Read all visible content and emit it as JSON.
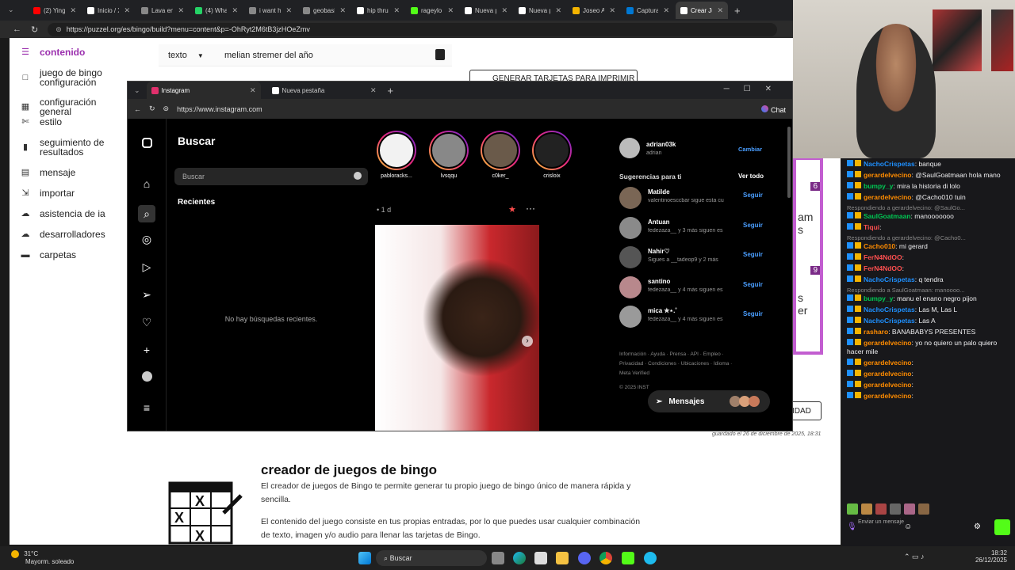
{
  "browser": {
    "tabs": [
      {
        "label": "(2) Ying y",
        "color": "#ff0000"
      },
      {
        "label": "Inicio / X",
        "color": "#ffffff"
      },
      {
        "label": "Lava en X",
        "color": "#888888"
      },
      {
        "label": "(4) Whats",
        "color": "#25d366"
      },
      {
        "label": "i want hi",
        "color": "#888888"
      },
      {
        "label": "geobasic",
        "color": "#888888"
      },
      {
        "label": "hip thrust",
        "color": "#ffffff"
      },
      {
        "label": "rageylo St",
        "color": "#53fc18"
      },
      {
        "label": "Nueva pe",
        "color": "#ffffff"
      },
      {
        "label": "Nueva pe",
        "color": "#ffffff"
      },
      {
        "label": "Joseo Au",
        "color": "#f4b400"
      },
      {
        "label": "Captura d",
        "color": "#0078d4"
      },
      {
        "label": "Crear Jue",
        "color": "#ffffff"
      }
    ],
    "url": "https://puzzel.org/es/bingo/build?menu=content&p=-OhRyt2M6tB3jzHOeZmv"
  },
  "editor": {
    "sidebar": [
      {
        "label": "contenido",
        "icon": "list-icon"
      },
      {
        "label": "juego de bingo configuración",
        "icon": "square-icon"
      },
      {
        "label": "configuración general",
        "icon": "grid-icon"
      },
      {
        "label": "estilo",
        "icon": "brush-icon"
      },
      {
        "label": "seguimiento de resultados",
        "icon": "bar-chart-icon"
      },
      {
        "label": "mensaje",
        "icon": "message-icon"
      },
      {
        "label": "importar",
        "icon": "import-icon"
      },
      {
        "label": "asistencia de ia",
        "icon": "brain-icon"
      },
      {
        "label": "desarrolladores",
        "icon": "cloud-icon"
      },
      {
        "label": "carpetas",
        "icon": "folder-icon"
      }
    ],
    "entry_type": "texto",
    "entry_value": "melian stremer del año",
    "generate_button": "GENERAR TARJETAS PARA IMPRIMIR",
    "saved_text": "guardado el 26 de diciembre de 2025, 18:31",
    "publicidad_button": "IDAD",
    "heading": "creador de juegos de bingo",
    "para1": "El creador de juegos de Bingo te permite generar tu propio juego de bingo único de manera rápida y sencilla.",
    "para2": "El contenido del juego consiste en tus propias entradas, por lo que puedes usar cualquier combinación de texto, imagen y/o audio para llenar las tarjetas de Bingo.",
    "card_numbers": [
      "6",
      "9"
    ],
    "card_texts": [
      "am",
      "s",
      "s",
      "er"
    ]
  },
  "instagram": {
    "tabs": [
      "Instagram",
      "Nueva pestaña"
    ],
    "url": "https://www.instagram.com",
    "search_title": "Buscar",
    "search_placeholder": "Buscar",
    "recent_label": "Recientes",
    "no_recent": "No hay búsquedas recientes.",
    "stories": [
      "pabloracks...",
      "lvsqqu",
      "c0ker_",
      "crisloix"
    ],
    "post_time": "1 d",
    "account": {
      "username": "adrian03k",
      "name": "adrian",
      "switch": "Cambiar"
    },
    "suggestions_title": "Sugerencias para ti",
    "see_all": "Ver todo",
    "suggestions": [
      {
        "name": "Matilde",
        "sub": "valentinoesccbar sigue esta cu",
        "follow": "Seguir"
      },
      {
        "name": "Antuan",
        "sub": "fedezaza__ y 3 más siguen es",
        "follow": "Seguir"
      },
      {
        "name": "Nahir♡",
        "sub": "Sigues a __tadeop9 y 2 más",
        "follow": "Seguir"
      },
      {
        "name": "santino",
        "sub": "fedezaza__ y 4 más siguen es",
        "follow": "Seguir"
      },
      {
        "name": "mica ✮⋆.˚",
        "sub": "fedezaza__ y 4 más siguen es",
        "follow": "Seguir"
      }
    ],
    "footer_line1": "Información · Ayuda · Prensa · API · Empleo ·",
    "footer_line2": "Privacidad · Condiciones · Ubicaciones · Idioma ·",
    "footer_line3": "Meta Verified",
    "copyright": "© 2025 INST",
    "messages": "Mensajes",
    "edge_chat": "Chat"
  },
  "chat": {
    "messages": [
      {
        "user": "NachoCrispetas",
        "text": "banque",
        "color": "b"
      },
      {
        "user": "gerardelvecino",
        "text": "@SaulGoatmaan hola mano",
        "color": "o"
      },
      {
        "user": "bumpy_y",
        "text": "mira la historia di lolo",
        "color": "g"
      },
      {
        "user": "gerardelvecino",
        "text": "@Cacho010 tuin",
        "color": "o"
      },
      {
        "reply": "Respondiendo a gerardelvecino: @SaulGo..."
      },
      {
        "user": "SaulGoatmaan",
        "text": "manooooooo",
        "color": "g"
      },
      {
        "user": "Tiqui",
        "text": "",
        "color": "r"
      },
      {
        "reply": "Respondiendo a gerardelvecino: @Cacho0..."
      },
      {
        "user": "Cacho010",
        "text": "mi gerard",
        "color": "o"
      },
      {
        "user": "FerN4NdOO",
        "text": "",
        "color": "r"
      },
      {
        "user": "FerN4NdOO",
        "text": "",
        "color": "r"
      },
      {
        "user": "NachoCrispetas",
        "text": "q tendra",
        "color": "b"
      },
      {
        "reply": "Respondiendo a SaulGoatmaan: manoooo..."
      },
      {
        "user": "bumpy_y",
        "text": "manu el enano negro pijon",
        "color": "g"
      },
      {
        "user": "NachoCrispetas",
        "text": "Las M, Las L",
        "color": "b"
      },
      {
        "user": "NachoCrispetas",
        "text": "Las A",
        "color": "b"
      },
      {
        "user": "rasharo",
        "text": "BANABABYS PRESENTES",
        "color": "o"
      },
      {
        "user": "gerardelvecino",
        "text": "yo no quiero un palo quiero hacer mile",
        "color": "o"
      },
      {
        "user": "gerardelvecino",
        "text": "",
        "color": "o"
      },
      {
        "user": "gerardelvecino",
        "text": "",
        "color": "o"
      },
      {
        "user": "gerardelvecino",
        "text": "",
        "color": "o"
      },
      {
        "user": "gerardelvecino",
        "text": "",
        "color": "o"
      }
    ],
    "send_label": "Enviar un mensaje"
  },
  "taskbar": {
    "weather_temp": "31°C",
    "weather_desc": "Mayorm. soleado",
    "search": "Buscar",
    "time": "18:32",
    "date": "26/12/2025"
  }
}
